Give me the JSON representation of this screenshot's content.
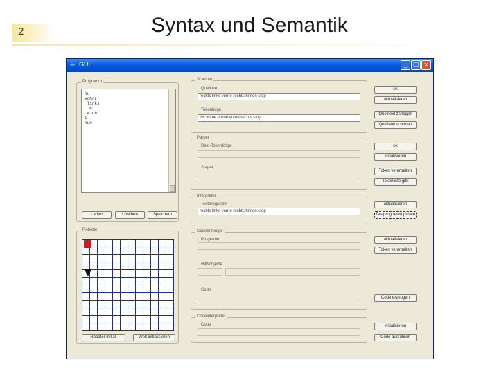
{
  "slide": {
    "number": "2",
    "title": "Syntax und Semantik"
  },
  "window": {
    "title": "GUI",
    "minimize": "_",
    "maximize": "□",
    "close": "×"
  },
  "programm": {
    "label": "Programm",
    "lines": [
      "hu",
      "vohrr",
      " links",
      "  e",
      " wich",
      "i",
      "hun"
    ],
    "buttons": {
      "laden": "Laden",
      "loeschen": "Löschen",
      "speichern": "Speichern"
    }
  },
  "scanner": {
    "label": "Scanner",
    "quelltext_label": "Quelltext",
    "quelltext_value": "rechts links vorne rechts hinten stop",
    "tokenfolge_label": "Tokenfolge",
    "tokenfolge_value": "lhs vorne vorne vorne rechts stop",
    "buttons": {
      "ok": "ok",
      "aktualisieren": "aktualisieren",
      "zerlegen": "Quelltext zerlegen",
      "scannen": "Quelltext scannen"
    }
  },
  "parser": {
    "label": "Parser",
    "restfolge_label": "Rest-Tokenfolge",
    "stapel_label": "Stapel",
    "buttons": {
      "ok": "ok",
      "initialisieren": "initialisieren",
      "verarbeiten": "Token verarbeiten",
      "tokenliste": "Tokenliste gibt"
    }
  },
  "interpreter": {
    "label": "Interpreter",
    "testprogramm_label": "Testprogramm",
    "testprogramm_value": "rechts links vorne rechts hinten stop",
    "buttons": {
      "aktualisieren": "aktualisieren",
      "entscheiden": "Testprogramm prüfen"
    }
  },
  "codeerzeuger": {
    "label": "Codeerzeuger",
    "programm_label": "Programm",
    "hilfsobjekte_label": "Hilfsobjekte",
    "code_label": "Code",
    "buttons": {
      "aktualisieren": "aktualisieren",
      "verarbeiten": "Token verarbeiten",
      "erzeugen": "Code erzeugen"
    }
  },
  "codeinterpreter": {
    "label": "Codeinterpreter",
    "code_label": "Code",
    "buttons": {
      "initialisieren": "initialisieren",
      "ausfuehren": "Code ausführen"
    }
  },
  "roboter": {
    "label": "Roboter",
    "buttons": {
      "init": "Roboter initial.",
      "welt": "Welt initialisieren"
    }
  },
  "colors": {
    "titlebar": "#0a5cdc",
    "grid": "#1a2d9c",
    "marker": "#e0141c",
    "window": "#ece9d8"
  }
}
